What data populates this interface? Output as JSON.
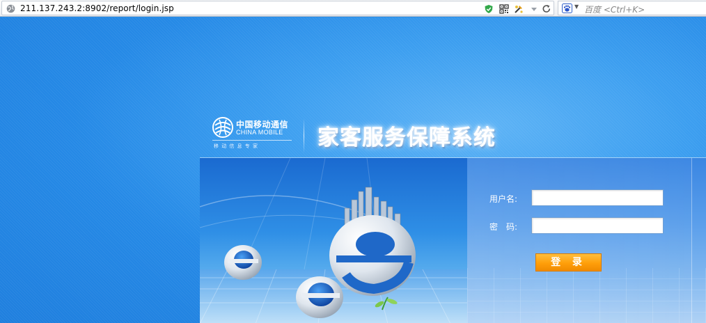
{
  "browser": {
    "url": "211.137.243.2:8902/report/login.jsp",
    "search_placeholder": "百度 <Ctrl+K>",
    "toolbar_icons": [
      "security-shield-icon",
      "qr-code-icon",
      "page-tool-icon",
      "dropdown-icon",
      "refresh-icon"
    ],
    "search_engine_icon": "baidu-paw-icon"
  },
  "brand": {
    "company_cn": "中国移动通信",
    "company_en": "CHINA MOBILE",
    "slogan": "移动信息专家",
    "system_title": "家客服务保障系统"
  },
  "login_form": {
    "username_label": "用户名:",
    "username_value": "",
    "password_label": "密　码:",
    "password_value": "",
    "submit_label": "登 录"
  },
  "colors": {
    "page_background": "#2a8ee8",
    "login_button": "#ff9f0a",
    "title_glow": "#cfe8ff"
  }
}
